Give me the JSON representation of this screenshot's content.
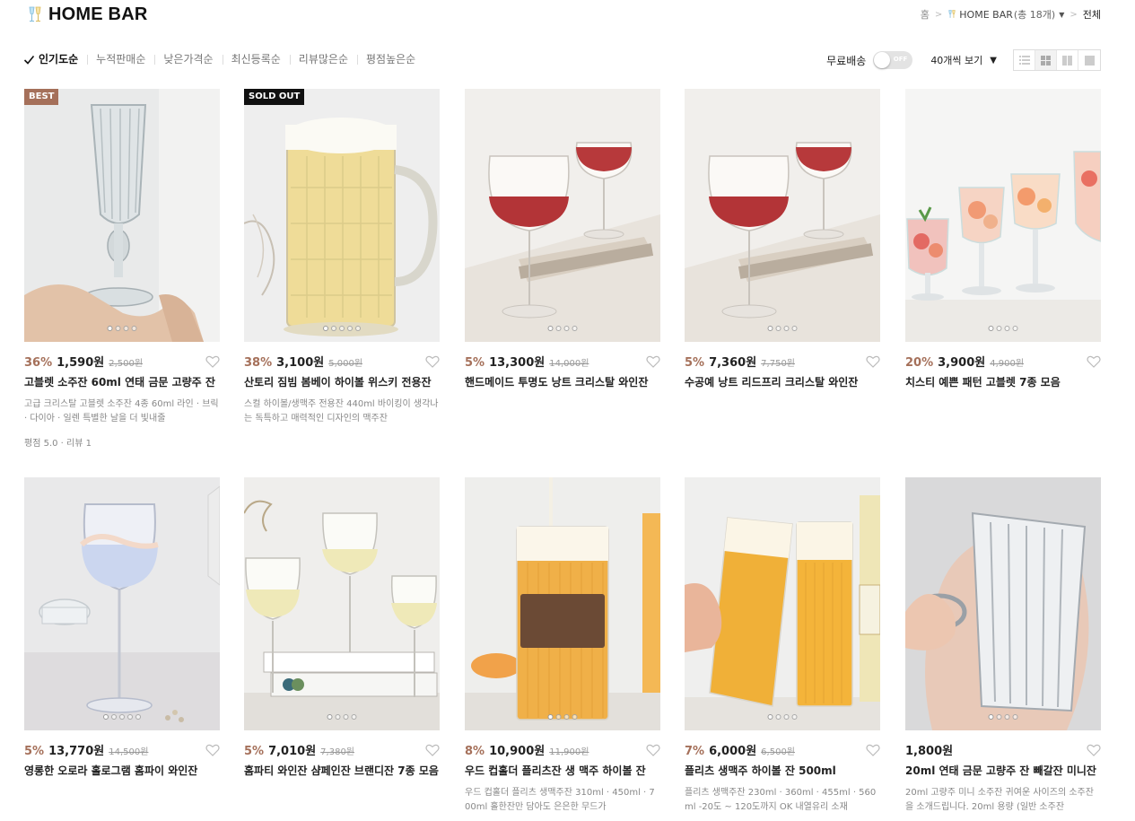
{
  "header": {
    "title": "HOME BAR"
  },
  "breadcrumb": {
    "home": "홈",
    "category": "HOME BAR",
    "count": "(총 18개)",
    "current": "전체"
  },
  "sort": {
    "active": "인기도순",
    "items": [
      "누적판매순",
      "낮은가격순",
      "최신등록순",
      "리뷰많은순",
      "평점높은순"
    ]
  },
  "tools": {
    "free_shipping_label": "무료배송",
    "toggle_state": "OFF",
    "per_page": "40개씩 보기"
  },
  "products": [
    {
      "badge": "BEST",
      "discount": "36%",
      "price": "1,590원",
      "original": "2,500원",
      "name": "고블렛 소주잔 60ml 연태 금문 고량주 잔",
      "desc": "고급 크리스탈 고블렛 소주잔 4종 60ml 라인 · 브릭 · 다이아 · 일렌 특별한 날을 더 빛내줄",
      "rating": "평점 5.0 · 리뷰 1"
    },
    {
      "badge": "SOLD OUT",
      "discount": "38%",
      "price": "3,100원",
      "original": "5,000원",
      "name": "산토리 짐빔 봄베이 하이볼 위스키 전용잔",
      "desc": "스컬 하이볼/생맥주 전용잔 440ml 바이킹이 생각나는 독특하고 매력적인 디자인의 맥주잔",
      "rating": ""
    },
    {
      "badge": "",
      "discount": "5%",
      "price": "13,300원",
      "original": "14,000원",
      "name": "핸드메이드 투명도 낭트 크리스탈 와인잔",
      "desc": "",
      "rating": ""
    },
    {
      "badge": "",
      "discount": "5%",
      "price": "7,360원",
      "original": "7,750원",
      "name": "수공예 낭트 리드프리 크리스탈 와인잔",
      "desc": "",
      "rating": ""
    },
    {
      "badge": "",
      "discount": "20%",
      "price": "3,900원",
      "original": "4,900원",
      "name": "치스티 예쁜 패턴 고블렛 7종 모음",
      "desc": "",
      "rating": ""
    },
    {
      "badge": "",
      "discount": "5%",
      "price": "13,770원",
      "original": "14,500원",
      "name": "영롱한 오로라 홀로그램 홈파이 와인잔",
      "desc": "",
      "rating": ""
    },
    {
      "badge": "",
      "discount": "5%",
      "price": "7,010원",
      "original": "7,380원",
      "name": "홈파티 와인잔 샴페인잔 브랜디잔 7종 모음",
      "desc": "",
      "rating": ""
    },
    {
      "badge": "",
      "discount": "8%",
      "price": "10,900원",
      "original": "11,900원",
      "name": "우드 컵홀더 플리츠잔 생 맥주 하이볼 잔",
      "desc": "우드 컵홀더 플리츠 생맥주잔 310ml · 450ml · 700ml 홀한잔만 담아도 은은한 무드가",
      "rating": ""
    },
    {
      "badge": "",
      "discount": "7%",
      "price": "6,000원",
      "original": "6,500원",
      "name": "플리츠 생맥주 하이볼 잔 500ml",
      "desc": "플리츠 생맥주잔 230ml · 360ml · 455ml · 560ml -20도 ~ 120도까지 OK 내열유리 소재",
      "rating": ""
    },
    {
      "badge": "",
      "discount": "",
      "price": "1,800원",
      "original": "",
      "name": "20ml 연태 금문 고량주 잔 빼갈잔 미니잔",
      "desc": "20ml 고량주 미니 소주잔 귀여운 사이즈의 소주잔을 소개드립니다. 20ml 용량 (일반 소주잔",
      "rating": ""
    }
  ]
}
